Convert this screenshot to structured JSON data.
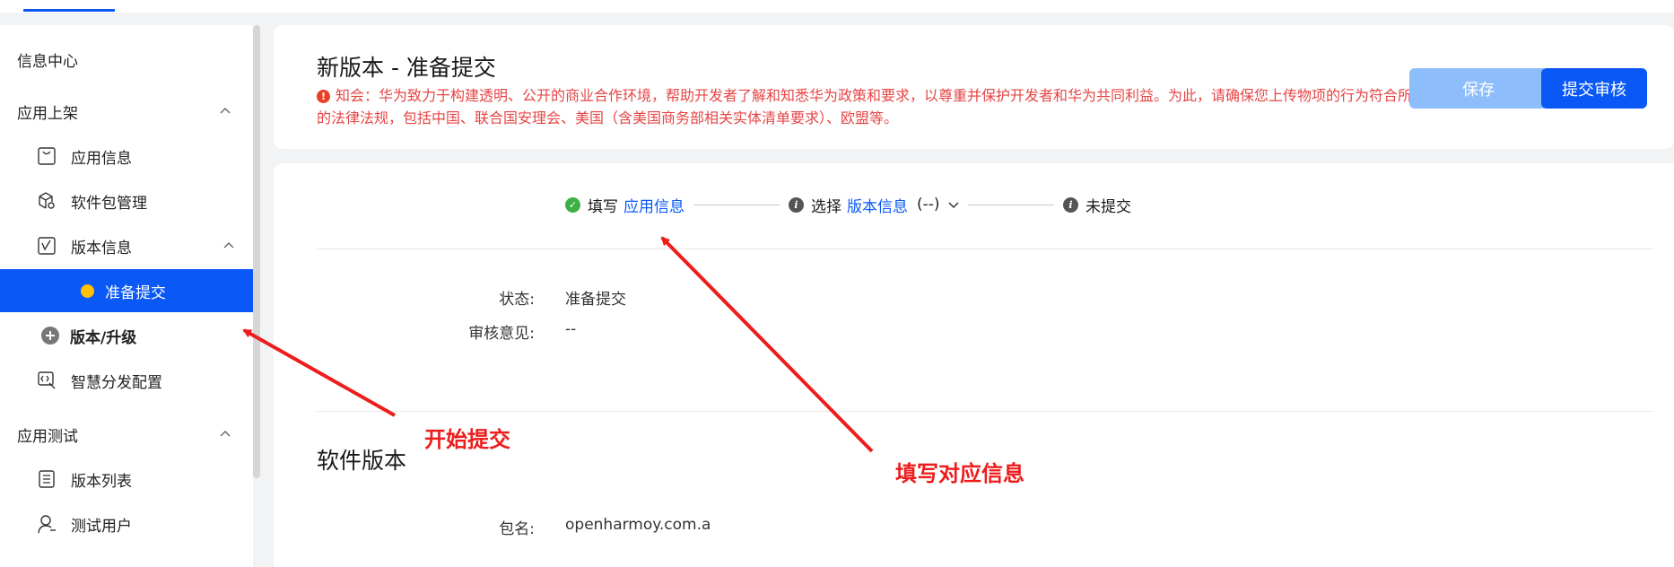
{
  "sidebar": {
    "info_center": "信息中心",
    "app_listing": "应用上架",
    "items": {
      "app_info": "应用信息",
      "package_mgmt": "软件包管理",
      "version_info": "版本信息",
      "prepare_submit": "准备提交",
      "version_upgrade": "版本/升级",
      "smart_distribution": "智慧分发配置"
    },
    "app_testing": "应用测试",
    "test_items": {
      "version_list": "版本列表",
      "test_users": "测试用户"
    }
  },
  "header": {
    "title": "新版本 - 准备提交",
    "notice": "知会：华为致力于构建透明、公开的商业合作环境，帮助开发者了解和知悉华为政策和要求，以尊重并保护开发者和华为共同利益。为此，请确保您上传物项的行为符合所有应适用的法律法规，包括中国、联合国安理会、美国（含美国商务部相关实体清单要求）、欧盟等。",
    "save_label": "保存",
    "submit_label": "提交审核"
  },
  "steps": {
    "step1_prefix": "填写",
    "step1_link": "应用信息",
    "step2_prefix": "选择",
    "step2_link": "版本信息",
    "step2_select": "(--)",
    "step3": "未提交"
  },
  "status": {
    "status_label": "状态:",
    "status_value": "准备提交",
    "review_label": "审核意见:",
    "review_value": "--"
  },
  "software_version": {
    "title": "软件版本",
    "package_label": "包名:",
    "package_value": "openharmoy.com.a"
  },
  "annotations": {
    "start_submit": "开始提交",
    "fill_info": "填写对应信息"
  },
  "colors": {
    "primary": "#0a59f7",
    "primary_disabled": "#8ebdfb",
    "notice_red": "#e64545",
    "annotation_red": "#ee1c1c",
    "active_dot": "#ffc107",
    "success_green": "#3cb043"
  }
}
